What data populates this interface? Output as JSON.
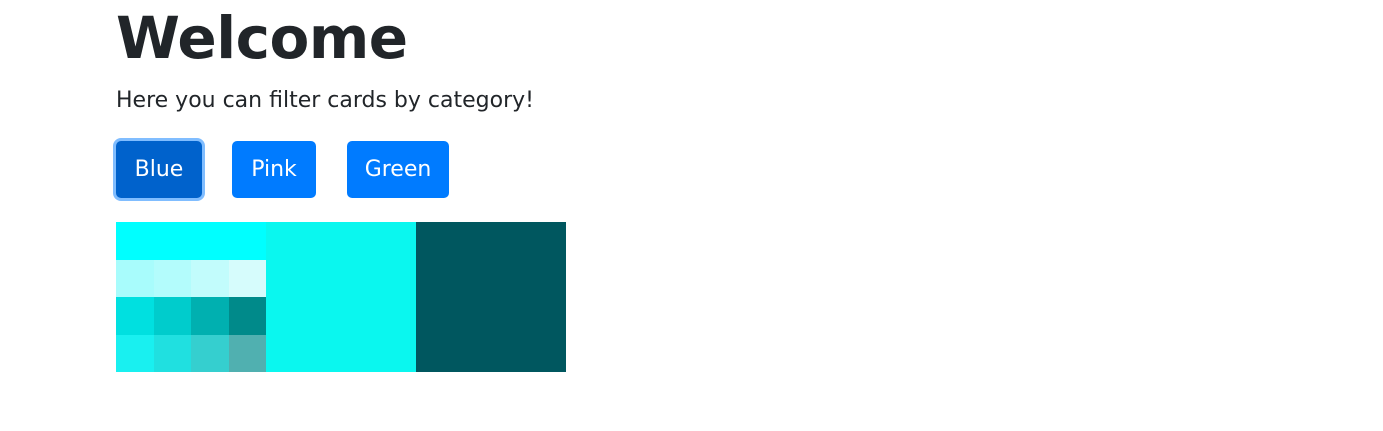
{
  "page": {
    "title": "Welcome",
    "subtitle": "Here you can filter cards by category!"
  },
  "filters": {
    "active": "Blue",
    "buttons": [
      {
        "label": "Blue"
      },
      {
        "label": "Pink"
      },
      {
        "label": "Green"
      }
    ]
  },
  "colors": {
    "button": "#007bff",
    "button_active": "#0062cc",
    "focus_ring": "#80bdff"
  },
  "cards": [
    {
      "name": "cyan-swatch-card",
      "top_color": "#00ffff",
      "swatches": [
        "#a8fcfc",
        "#b3fcfc",
        "#c2fcfc",
        "#d6fcfc",
        "#00e0e0",
        "#00cccc",
        "#00b0b0",
        "#008a8a",
        "#19f0f0",
        "#20e0e0",
        "#35cfcf",
        "#50b0b0"
      ]
    },
    {
      "name": "turquoise-card",
      "color": "#0af7ef"
    },
    {
      "name": "dark-teal-card",
      "color": "#00575f"
    }
  ]
}
